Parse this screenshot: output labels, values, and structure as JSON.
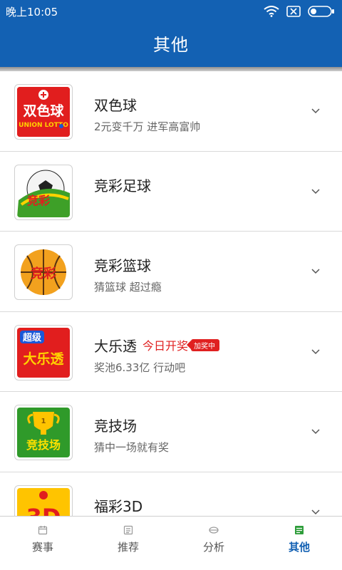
{
  "status": {
    "time": "晚上10:05"
  },
  "header": {
    "title": "其他"
  },
  "items": [
    {
      "title": "双色球",
      "subtitle": "2元变千万 进军高富帅",
      "logo_text": "双色球",
      "logo_sub": "UNION LOTTO"
    },
    {
      "title": "竞彩足球",
      "subtitle": "",
      "logo_text": "竞彩"
    },
    {
      "title": "竞彩篮球",
      "subtitle": "猜篮球 超过瘾",
      "logo_text": "竞彩"
    },
    {
      "title": "大乐透",
      "subtitle": "奖池6.33亿 行动吧",
      "tag": "今日开奖",
      "badge": "加奖中",
      "logo_text_top": "超级",
      "logo_text": "大乐透"
    },
    {
      "title": "竞技场",
      "subtitle": "猜中一场就有奖",
      "logo_text": "竞技场"
    },
    {
      "title": "福彩3D",
      "subtitle": "",
      "logo_text": "3D"
    }
  ],
  "tabs": [
    {
      "label": "赛事",
      "icon": "calendar-icon",
      "active": false
    },
    {
      "label": "推荐",
      "icon": "recommend-icon",
      "active": false
    },
    {
      "label": "分析",
      "icon": "analysis-icon",
      "active": false
    },
    {
      "label": "其他",
      "icon": "other-icon",
      "active": true
    }
  ],
  "colors": {
    "header": "#1361b3",
    "accent": "#e02020"
  }
}
